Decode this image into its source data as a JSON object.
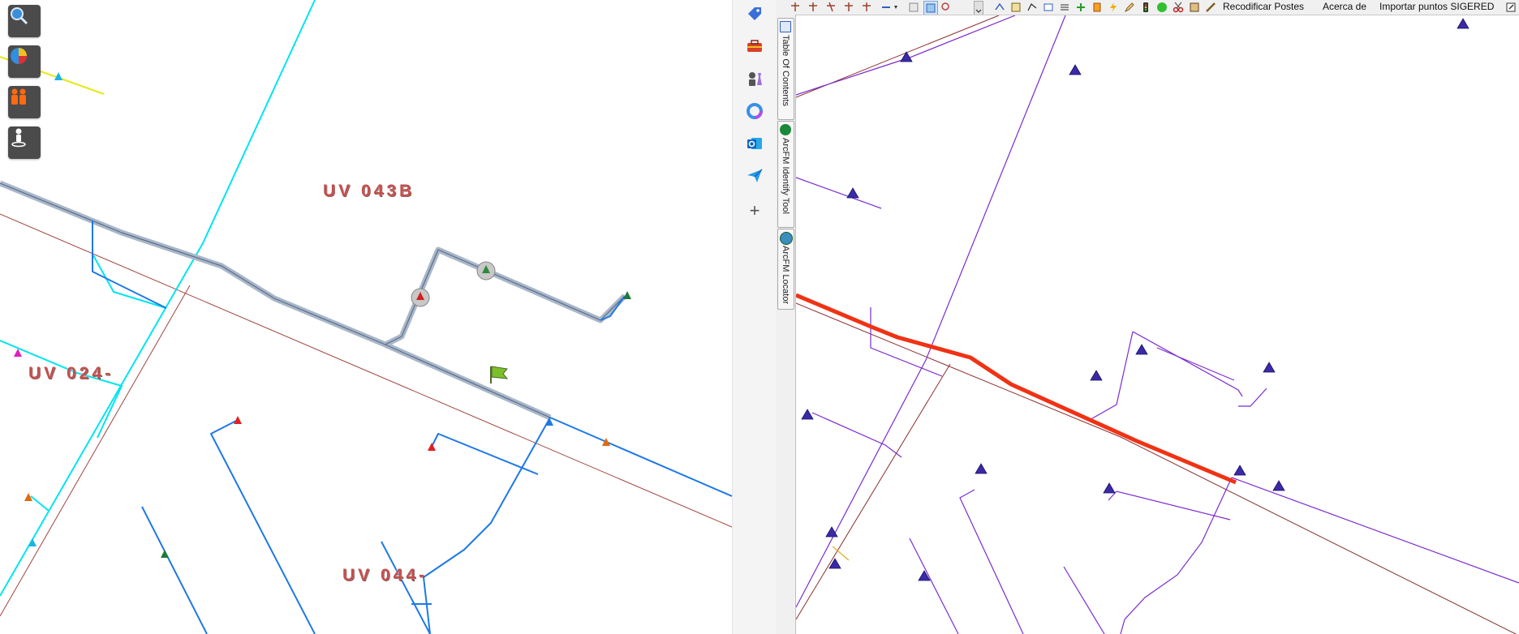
{
  "left_map": {
    "labels": [
      "UV 043B",
      "UV 024-",
      "UV 044-"
    ],
    "tools": [
      {
        "name": "zoom-search-tool",
        "icon": "magnifier-globe-icon"
      },
      {
        "name": "pie-chart-tool",
        "icon": "pie-chart-icon"
      },
      {
        "name": "people-tool",
        "icon": "people-icon"
      },
      {
        "name": "locate-person-tool",
        "icon": "person-pin-icon"
      }
    ],
    "colors": {
      "background": "#ffffff",
      "primary_line": "#1e78e6",
      "feeder_line": "#00e5ee",
      "parcel_line": "#a0443f",
      "highlight": "#a9b7c8"
    }
  },
  "app_bar": {
    "icons": [
      "tag-icon",
      "toolbox-icon",
      "chess-figure-icon",
      "copilot-icon",
      "outlook-icon",
      "send-icon"
    ],
    "add_label": "+"
  },
  "arcmap": {
    "toolbar": {
      "recodify_label": "Recodificar Postes",
      "about_label": "Acerca de",
      "import_label": "Importar puntos SIGERED"
    },
    "dock_tabs": [
      {
        "label": "Table Of Contents",
        "icon": "table-of-contents-icon"
      },
      {
        "label": "ArcFM Identify Tool",
        "icon": "info-icon"
      },
      {
        "label": "ArcFM Locator",
        "icon": "globe-locator-icon"
      }
    ],
    "colors": {
      "network_line": "#7b2bd0",
      "selected_segment": "#f03214",
      "parcel_line": "#8b2d2d",
      "pole_symbol": "#3a2aa8"
    }
  }
}
